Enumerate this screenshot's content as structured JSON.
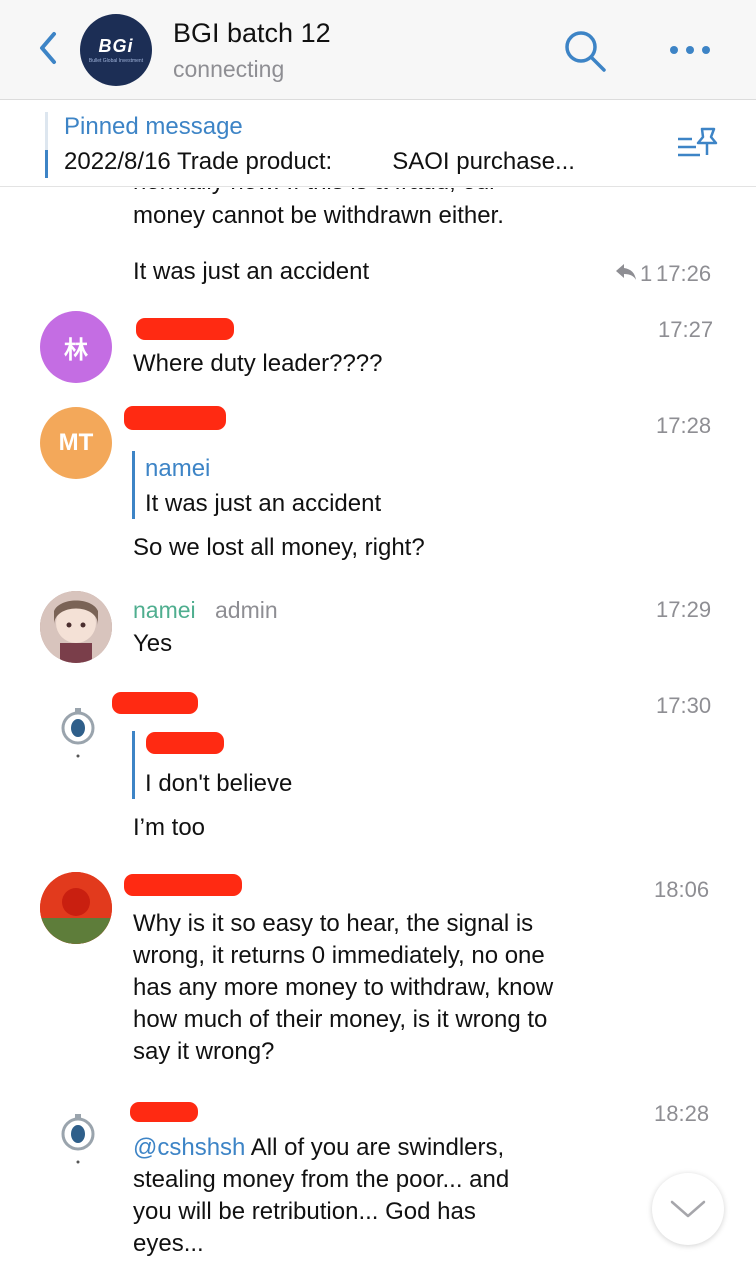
{
  "header": {
    "title": "BGI batch 12",
    "status": "connecting",
    "avatar_logo": "BGi",
    "avatar_tagline": "Bullet Global Investment"
  },
  "pinned": {
    "title": "Pinned message",
    "text": "2022/8/16 Trade product:         SAOI purchase..."
  },
  "messages": {
    "m0": {
      "line1": "normally now. If this is a fraud, our",
      "line2": "money cannot be withdrawn either."
    },
    "m1": {
      "text": "It was just an accident",
      "reply_count": "1",
      "time": "17:26"
    },
    "m2": {
      "avatar_text": "林",
      "text": "Where duty leader????",
      "time": "17:27"
    },
    "m3": {
      "avatar_text": "MT",
      "reply_name": "namei",
      "reply_text": "It was just an accident",
      "text": "So we lost all money, right?",
      "time": "17:28"
    },
    "m4": {
      "sender": "namei",
      "role": "admin",
      "text": "Yes",
      "time": "17:29"
    },
    "m5": {
      "reply_text": "I don't believe",
      "text": "I’m too",
      "time": "17:30"
    },
    "m6": {
      "lines": [
        "Why is it so easy to hear, the signal is",
        "wrong, it returns 0 immediately, no one",
        "has any more money to withdraw, know",
        "how much of their money, is it wrong to",
        "say it wrong?"
      ],
      "time": "18:06"
    },
    "m7": {
      "mention": "@cshshsh",
      "line1_rest": " All of you are swindlers,",
      "line2": "stealing money from the poor... and",
      "line3": "you will be retribution... God has",
      "line4": "eyes...",
      "time": "18:28"
    }
  },
  "colors": {
    "accent": "#3d84c6",
    "redaction": "#ff2a12",
    "admin_name": "#4fae8f",
    "avatar_lin": "#c46de3",
    "avatar_mt": "#f3a85a"
  },
  "icons": [
    "back-chevron-icon",
    "search-icon",
    "more-dots-icon",
    "pinned-list-icon",
    "reply-arrow-icon",
    "chevron-down-icon"
  ]
}
